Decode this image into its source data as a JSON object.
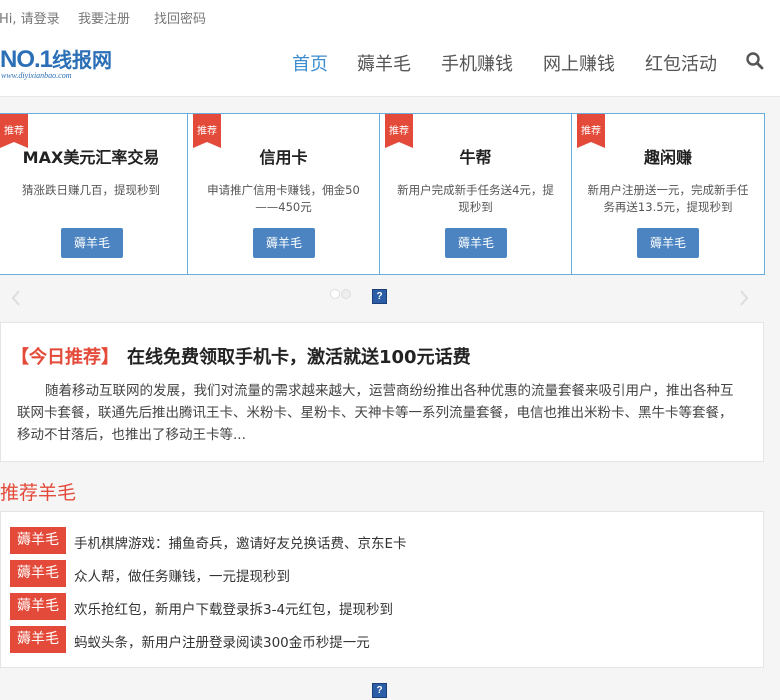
{
  "topbar": {
    "greeting": "Hi, 请登录",
    "register": "我要注册",
    "recover": "找回密码"
  },
  "logo": {
    "brand_no": "NO.1",
    "brand_cn": "线报网",
    "url": "www.diyixianbao.com"
  },
  "nav": {
    "items": [
      "首页",
      "薅羊毛",
      "手机赚钱",
      "网上赚钱",
      "红包活动"
    ],
    "active": "首页"
  },
  "carousel": {
    "badge": "推荐",
    "cards": [
      {
        "title": "MAX美元汇率交易",
        "desc": "猜涨跌日赚几百，提现秒到",
        "button": "薅羊毛"
      },
      {
        "title": "信用卡",
        "desc": "申请推广信用卡赚钱，佣金50——450元",
        "button": "薅羊毛"
      },
      {
        "title": "牛帮",
        "desc": "新用户完成新手任务送4元，提现秒到",
        "button": "薅羊毛"
      },
      {
        "title": "趣闲赚",
        "desc": "新用户注册送一元，完成新手任务再送13.5元，提现秒到",
        "button": "薅羊毛"
      }
    ]
  },
  "help_icon": "?",
  "feature": {
    "tag": "【今日推荐】",
    "title": "在线免费领取手机卡，激活就送100元话费",
    "body": "随着移动互联网的发展，我们对流量的需求越来越大，运营商纷纷推出各种优惠的流量套餐来吸引用户，推出各种互联网卡套餐，联通先后推出腾讯王卡、米粉卡、星粉卡、天神卡等一系列流量套餐，电信也推出米粉卡、黑牛卡等套餐，移动不甘落后，也推出了移动王卡等..."
  },
  "recommend": {
    "title": "推荐羊毛",
    "items": [
      {
        "badge": "薅羊毛",
        "text": "手机棋牌游戏：捕鱼奇兵，邀请好友兑换话费、京东E卡"
      },
      {
        "badge": "薅羊毛",
        "text": "众人帮，做任务赚钱，一元提现秒到"
      },
      {
        "badge": "薅羊毛",
        "text": "欢乐抢红包，新用户下载登录拆3-4元红包，提现秒到"
      },
      {
        "badge": "薅羊毛",
        "text": "蚂蚁头条，新用户注册登录阅读300金币秒提一元"
      }
    ]
  },
  "colors": {
    "accent_blue": "#3c8dd0",
    "button_blue": "#4b84c1",
    "red": "#e34a3a",
    "card_border": "#6aaede"
  },
  "icons": {
    "search": "search-icon",
    "prev": "chevron-left-icon",
    "next": "chevron-right-icon",
    "help": "help-icon"
  }
}
